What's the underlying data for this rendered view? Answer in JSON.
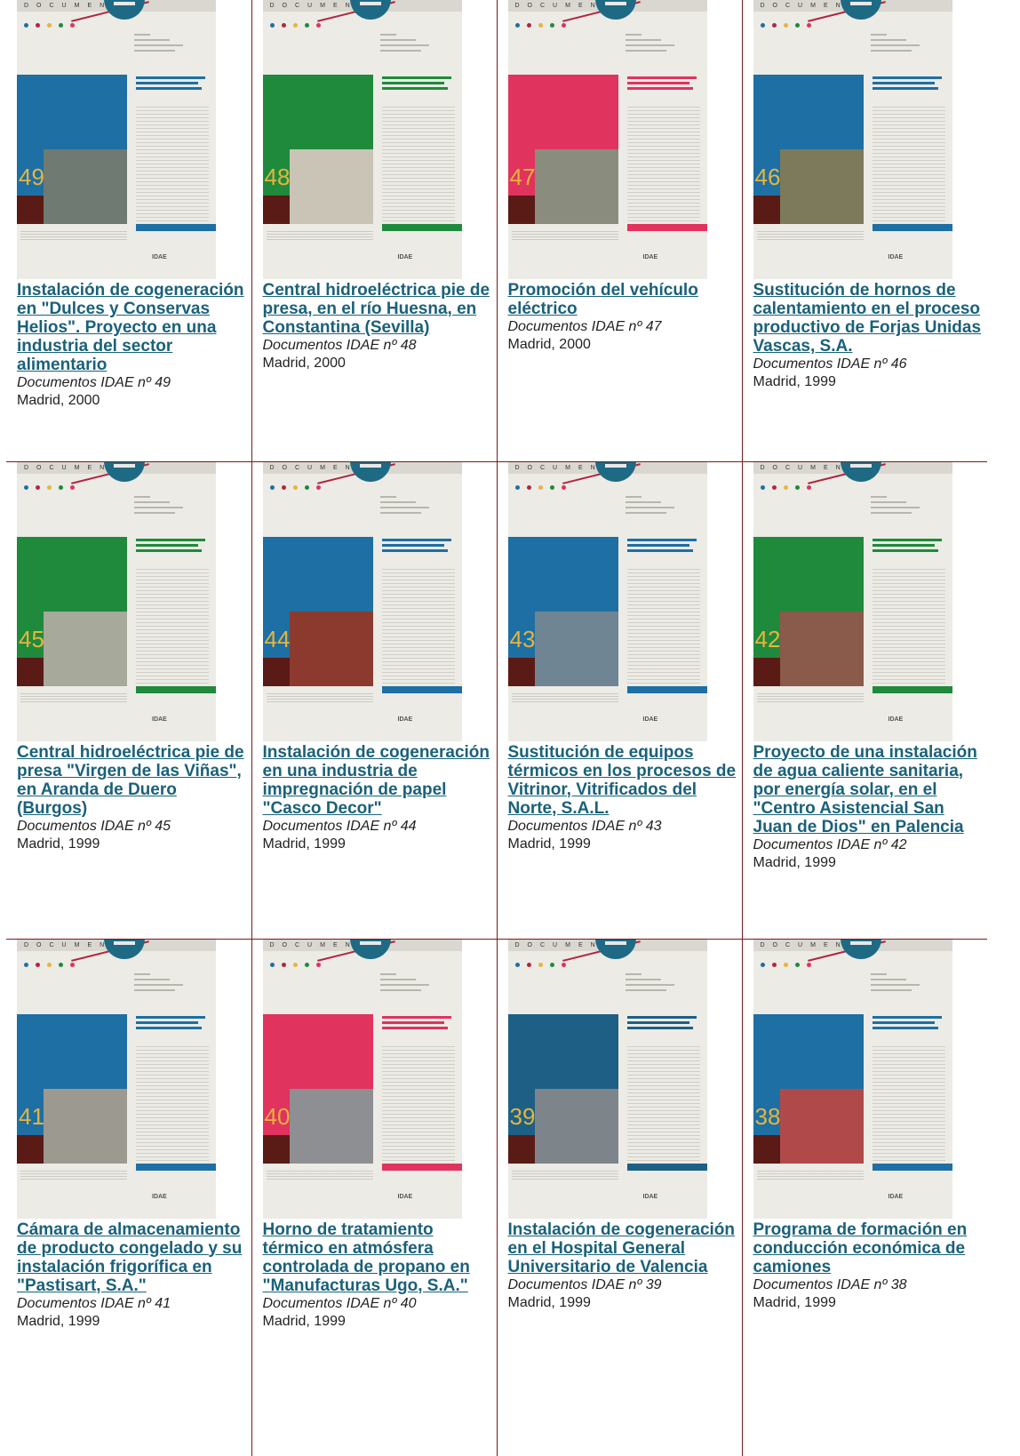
{
  "colors": {
    "link": "#1a617a",
    "border": "#7a1a1a",
    "blue": "#1e6fa3",
    "green": "#1f8a3c",
    "pink": "#e0335e",
    "number": "#e8b43c",
    "dark": "#5a1a15"
  },
  "cover_header": "DOCUMENTOS",
  "rows": [
    {
      "items": [
        {
          "number": "49",
          "accent": "#1e6fa3",
          "photo": "#6f7b72",
          "title": "Instalación de cogeneración en \"Dulces y Conservas Helios\". Proyecto en una industria del sector alimentario",
          "series": "Documentos IDAE nº 49",
          "place": "Madrid, 2000"
        },
        {
          "number": "48",
          "accent": "#1f8a3c",
          "photo": "#c9c4b5",
          "title": "Central hidroeléctrica pie de presa, en el río Huesna, en Constantina (Sevilla)",
          "series": "Documentos IDAE nº 48",
          "place": "Madrid, 2000"
        },
        {
          "number": "47",
          "accent": "#e0335e",
          "photo": "#8a8c7e",
          "title": "Promoción del vehículo eléctrico",
          "series": "Documentos IDAE nº 47",
          "place": "Madrid, 2000"
        },
        {
          "number": "46",
          "accent": "#1e6fa3",
          "photo": "#7c7a5a",
          "title": "Sustitución de hornos de calentamiento en el proceso productivo de Forjas Unidas Vascas, S.A.",
          "series": "Documentos IDAE nº 46",
          "place": "Madrid, 1999"
        }
      ]
    },
    {
      "items": [
        {
          "number": "45",
          "accent": "#1f8a3c",
          "photo": "#a7a99a",
          "title": "Central hidroeléctrica pie de presa \"Virgen de las Viñas\", en Aranda de Duero (Burgos)",
          "series": "Documentos IDAE nº 45",
          "place": "Madrid, 1999"
        },
        {
          "number": "44",
          "accent": "#1e6fa3",
          "photo": "#8c3a2e",
          "title": "Instalación de cogeneración en una industria de impregnación de papel \"Casco Decor\"",
          "series": "Documentos IDAE nº 44",
          "place": "Madrid, 1999"
        },
        {
          "number": "43",
          "accent": "#1e6fa3",
          "photo": "#6f8594",
          "title": "Sustitución de equipos térmicos en los procesos de Vitrinor, Vitrificados del Norte, S.A.L.",
          "series": "Documentos IDAE nº 43",
          "place": "Madrid, 1999"
        },
        {
          "number": "42",
          "accent": "#1f8a3c",
          "photo": "#8a5a4a",
          "title": "Proyecto de una instalación de agua caliente sanitaria, por energía solar, en el \"Centro Asistencial San Juan de Dios\" en Palencia",
          "series": "Documentos IDAE nº 42",
          "place": "Madrid, 1999"
        }
      ]
    },
    {
      "items": [
        {
          "number": "41",
          "accent": "#1e6fa3",
          "photo": "#9c9a90",
          "title": "Cámara de almacenamiento de producto congelado y su instalación frigorífica en \"Pastisart, S.A.\"",
          "series": "Documentos IDAE nº 41",
          "place": "Madrid, 1999"
        },
        {
          "number": "40",
          "accent": "#e0335e",
          "photo": "#8d8f92",
          "title": "Horno de tratamiento térmico en atmósfera controlada de propano en \"Manufacturas Ugo, S.A.\"",
          "series": "Documentos IDAE nº 40",
          "place": "Madrid, 1999"
        },
        {
          "number": "39",
          "accent": "#1e5f86",
          "photo": "#7d858a",
          "title": "Instalación de cogeneración en el Hospital General Universitario de Valencia",
          "series": "Documentos IDAE nº 39",
          "place": "Madrid, 1999"
        },
        {
          "number": "38",
          "accent": "#1e6fa3",
          "photo": "#b04a4a",
          "title": "Programa de formación en conducción económica de camiones",
          "series": "Documentos IDAE nº 38",
          "place": "Madrid, 1999"
        }
      ]
    }
  ]
}
